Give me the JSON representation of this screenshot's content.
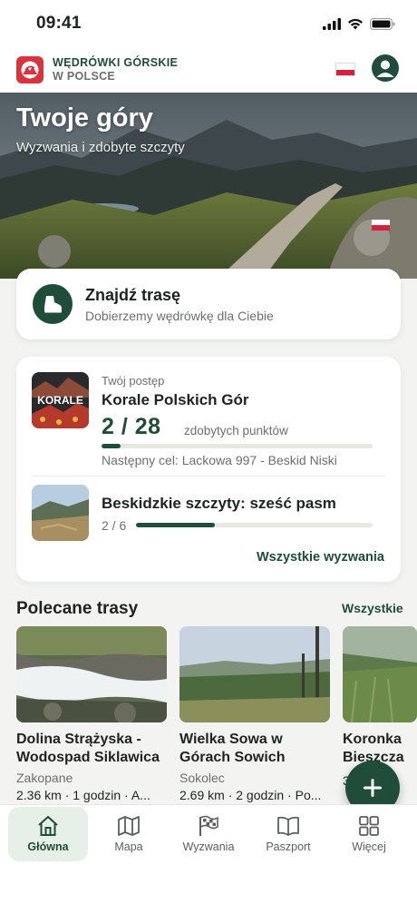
{
  "status_bar": {
    "time": "09:41"
  },
  "header": {
    "brand_line1": "WĘDRÓWKI GÓRSKIE",
    "brand_line2": "W POLSCE"
  },
  "hero": {
    "title": "Twoje góry",
    "subtitle": "Wyzwania i zdobyte szczyty"
  },
  "find_route": {
    "title": "Znajdź trasę",
    "subtitle": "Dobierzemy wędrówkę dla Ciebie"
  },
  "challenges": {
    "progress_label": "Twój postęp",
    "primary": {
      "thumb_text": "KORALE",
      "name": "Korale Polskich Gór",
      "count": "2 / 28",
      "count_label": "zdobytych punktów",
      "progress": 0.071,
      "next": "Następny cel: Lackowa 997 - Beskid Niski"
    },
    "secondary": {
      "name": "Beskidzkie szczyty: sześć pasm",
      "count": "2 / 6",
      "progress": 0.333
    },
    "all_link": "Wszystkie wyzwania"
  },
  "recommended": {
    "title": "Polecane trasy",
    "all_link": "Wszystkie",
    "routes": [
      {
        "name_line1": "Dolina Strążyska -",
        "name_line2": "Wodospad Siklawica",
        "location": "Zakopane",
        "meta": "2.36 km · 1 godzin · A..."
      },
      {
        "name_line1": "Wielka Sowa w",
        "name_line2": "Górach Sowich",
        "location": "Sokolec",
        "meta": "2.69 km · 2 godzin · Po..."
      },
      {
        "name_line1": "Koronka",
        "name_line2": "Bieszcza",
        "location": "",
        "meta": "3"
      }
    ]
  },
  "bottom_nav": {
    "items": [
      {
        "label": "Główna",
        "icon": "home-icon"
      },
      {
        "label": "Mapa",
        "icon": "map-icon"
      },
      {
        "label": "Wyzwania",
        "icon": "flag-icon"
      },
      {
        "label": "Paszport",
        "icon": "book-icon"
      },
      {
        "label": "Więcej",
        "icon": "grid-icon"
      }
    ]
  },
  "colors": {
    "accent": "#1f4d3a",
    "brand_red": "#d8343d",
    "background": "#f3f4f1"
  }
}
